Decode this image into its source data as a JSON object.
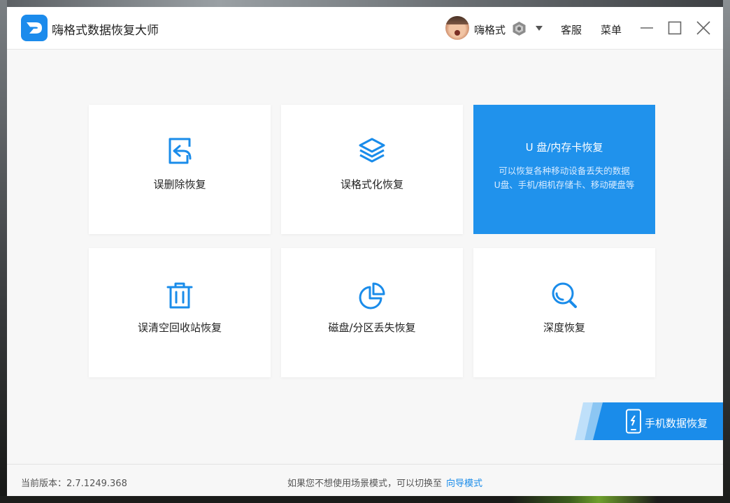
{
  "app": {
    "title": "嗨格式数据恢复大师"
  },
  "header": {
    "username": "嗨格式",
    "support_label": "客服",
    "menu_label": "菜单"
  },
  "cards": [
    {
      "label": "误删除恢复",
      "icon": "document-restore-icon"
    },
    {
      "label": "误格式化恢复",
      "icon": "layers-icon"
    },
    {
      "label": "U 盘/内存卡恢复",
      "icon": "",
      "desc_lines": [
        "可以恢复各种移动设备丢失的数据",
        "U盘、手机/相机存储卡、移动硬盘等"
      ]
    },
    {
      "label": "误清空回收站恢复",
      "icon": "trash-icon"
    },
    {
      "label": "磁盘/分区丢失恢复",
      "icon": "pie-chart-icon"
    },
    {
      "label": "深度恢复",
      "icon": "magnifier-icon"
    }
  ],
  "mobile": {
    "label": "手机数据恢复"
  },
  "footer": {
    "version": "当前版本：2.7.1249.368",
    "hint": "如果您不想使用场景模式，可以切换至",
    "link": "向导模式"
  },
  "colors": {
    "accent": "#1a8cea",
    "active_card": "#2092ec"
  }
}
